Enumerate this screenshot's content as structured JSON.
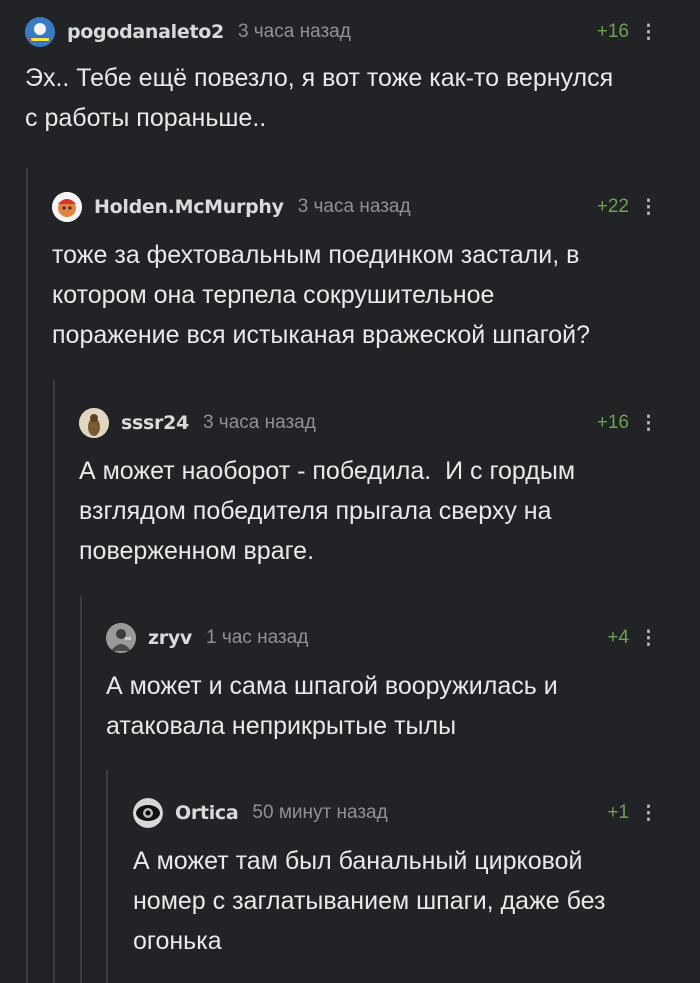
{
  "comments": [
    {
      "username": "pogodanaleto2",
      "time": "3 часа назад",
      "rating": "+16",
      "more": "⋮",
      "text": "Эх.. Тебе ещё повезло, я вот тоже как-то вернулся\nс работы пораньше.."
    },
    {
      "username": "Holden.McMurphy",
      "time": "3 часа назад",
      "rating": "+22",
      "more": "⋮",
      "text": "тоже за фехтовальным поединком застали, в\nкотором она терпела сокрушительное\nпоражение вся истыканая вражеской шпагой?"
    },
    {
      "username": "sssr24",
      "time": "3 часа назад",
      "rating": "+16",
      "more": "⋮",
      "text": "А может наоборот - победила.  И с гордым\nвзглядом победителя прыгала сверху на\nповерженном враге."
    },
    {
      "username": "zryv",
      "time": "1 час назад",
      "rating": "+4",
      "more": "⋮",
      "text": "А может и сама шпагой вооружилась и\nатаковала неприкрытые тылы"
    },
    {
      "username": "Ortica",
      "time": "50 минут назад",
      "rating": "+1",
      "more": "⋮",
      "text": "А может там был банальный цирковой\nномер с заглатыванием шпаги, даже без\nогонька"
    }
  ]
}
